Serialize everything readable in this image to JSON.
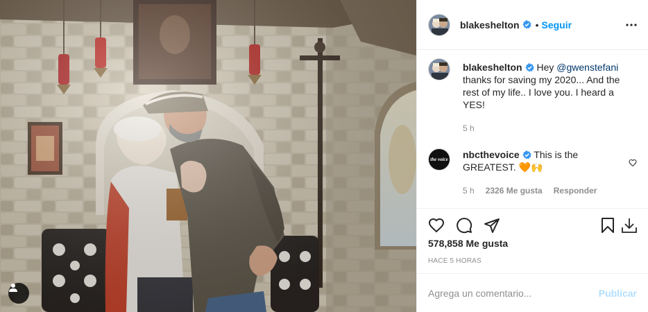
{
  "post": {
    "author": "blakeshelton",
    "follow_label": "Seguir",
    "dot": "•",
    "more_icon": "more-horizontal-icon",
    "caption": {
      "user": "blakeshelton",
      "text_before": "Hey ",
      "mention": "@gwenstefani",
      "text_after": " thanks for saving my 2020... And the rest of my life.. I love you. I heard a YES!",
      "time": "5 h"
    },
    "comments": [
      {
        "user": "nbcthevoice",
        "avatar_text": "the voice",
        "text": "This is the GREATEST.",
        "emoji": "🧡🙌",
        "time": "5 h",
        "likes": "2326 Me gusta",
        "reply_label": "Responder"
      }
    ],
    "likes_count": "578,858",
    "likes_label": "Me gusta",
    "timestamp": "HACE 5 HORAS",
    "comment_placeholder": "Agrega un comentario...",
    "publish_label": "Publicar"
  },
  "colors": {
    "accent": "#0095f6",
    "verified": "#3897f0",
    "publish_disabled": "#b2dffc",
    "muted": "#8e8e8e"
  }
}
